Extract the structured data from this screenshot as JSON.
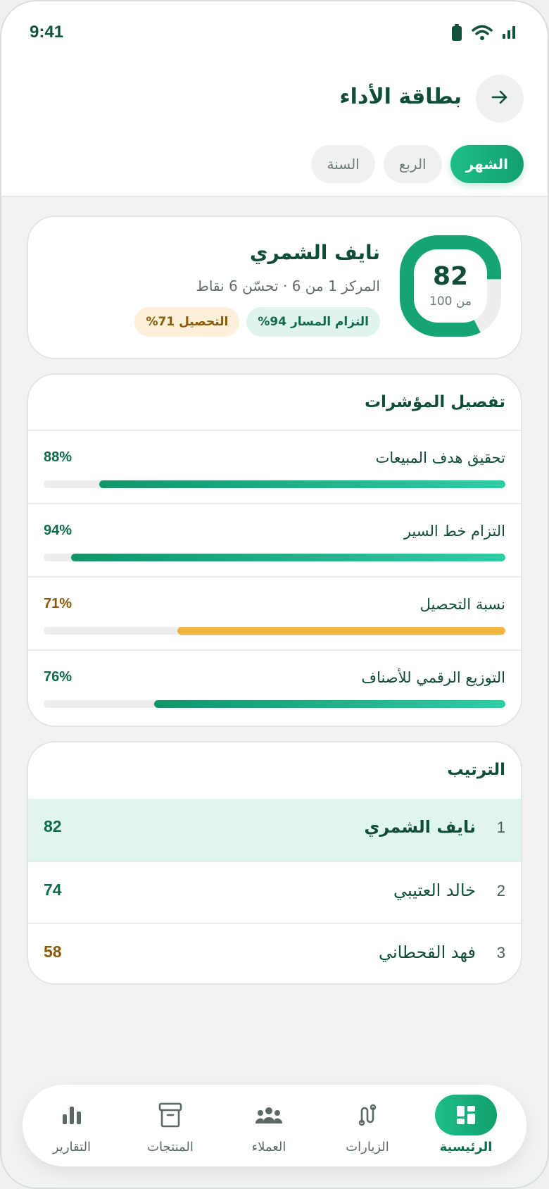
{
  "status_bar": {
    "time": "9:41"
  },
  "header": {
    "title": "بطاقة الأداء",
    "tabs": [
      {
        "label": "الشهر",
        "active": true
      },
      {
        "label": "الربع",
        "active": false
      },
      {
        "label": "السنة",
        "active": false
      }
    ]
  },
  "profile": {
    "name": "نايف الشمري",
    "subtitle": "المركز 1 من 6 · تحسّن 6 نقاط",
    "score": "82",
    "score_of": "من 100",
    "score_fraction": 0.82,
    "chips": [
      {
        "label": "التزام المسار 94%",
        "tone": "green"
      },
      {
        "label": "التحصيل 71%",
        "tone": "amber"
      }
    ]
  },
  "kpis": {
    "title": "تفصيل المؤشرات",
    "items": [
      {
        "label": "تحقيق هدف المبيعات",
        "value": "88%",
        "percent": 88,
        "tone": "green"
      },
      {
        "label": "التزام خط السير",
        "value": "94%",
        "percent": 94,
        "tone": "green"
      },
      {
        "label": "نسبة التحصيل",
        "value": "71%",
        "percent": 71,
        "tone": "amber"
      },
      {
        "label": "التوزيع الرقمي للأصناف",
        "value": "76%",
        "percent": 76,
        "tone": "green"
      }
    ]
  },
  "ranking": {
    "title": "الترتيب",
    "rows": [
      {
        "pos": "1",
        "name": "نايف الشمري",
        "score": "82",
        "me": true
      },
      {
        "pos": "2",
        "name": "خالد العتيبي",
        "score": "74",
        "me": false
      },
      {
        "pos": "3",
        "name": "فهد القحطاني",
        "score": "58",
        "me": false
      }
    ]
  },
  "nav": {
    "items": [
      {
        "label": "الرئيسية",
        "icon": "dashboard-icon",
        "active": true
      },
      {
        "label": "الزيارات",
        "icon": "route-icon",
        "active": false
      },
      {
        "label": "العملاء",
        "icon": "users-icon",
        "active": false
      },
      {
        "label": "المنتجات",
        "icon": "archive-box-icon",
        "active": false
      },
      {
        "label": "التقارير",
        "icon": "bar-chart-icon",
        "active": false
      }
    ]
  },
  "colors": {
    "accent": "#12a06d",
    "accent_light": "#29d0a6",
    "amber": "#f2b441",
    "text_dark": "#0f4d39"
  }
}
